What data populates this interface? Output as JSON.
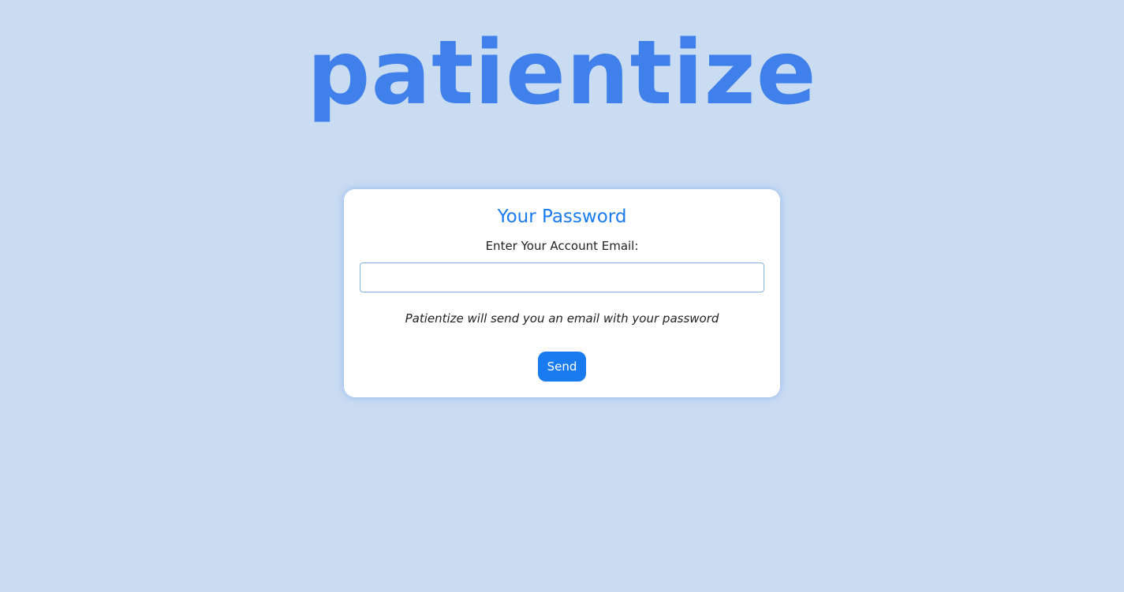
{
  "brand": {
    "logo_text": "patientize",
    "color": "#4080ea"
  },
  "form": {
    "title": "Your Password",
    "email_label": "Enter Your Account Email:",
    "email_value": "",
    "email_placeholder": "",
    "hint": "Patientize will send you an email with your password",
    "send_label": "Send",
    "accent_color": "#1a7bf0"
  },
  "page": {
    "background_color": "#cadcf2"
  }
}
